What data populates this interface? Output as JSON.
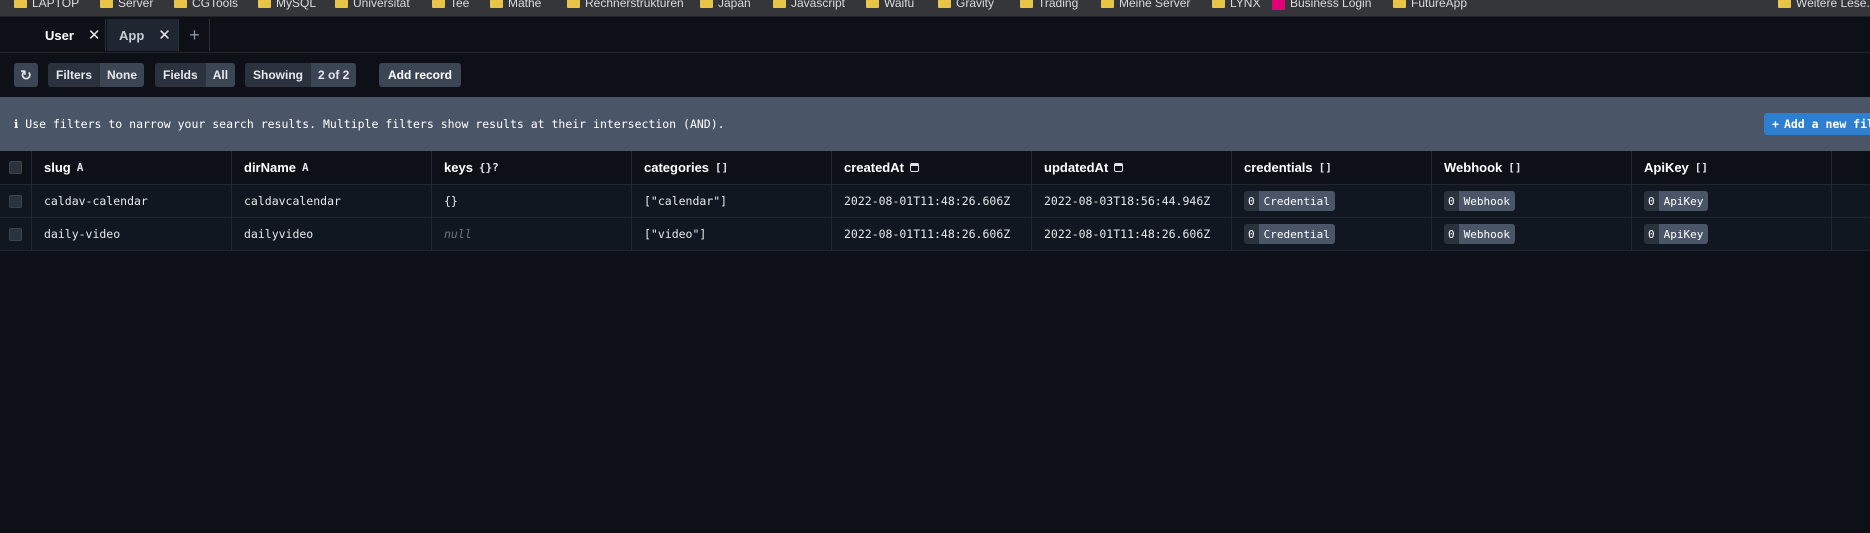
{
  "bookmarks": [
    {
      "label": "LAPTOP",
      "icon": "folder-icon"
    },
    {
      "label": "Server",
      "icon": "folder-icon"
    },
    {
      "label": "CGTools",
      "icon": "folder-icon"
    },
    {
      "label": "MySQL",
      "icon": "folder-icon"
    },
    {
      "label": "Universität",
      "icon": "folder-icon"
    },
    {
      "label": "Tee",
      "icon": "folder-icon"
    },
    {
      "label": "Mathe",
      "icon": "folder-icon"
    },
    {
      "label": "Rechnerstrukturen",
      "icon": "folder-icon"
    },
    {
      "label": "Japan",
      "icon": "folder-icon"
    },
    {
      "label": "Javascript",
      "icon": "folder-icon"
    },
    {
      "label": "Waifu",
      "icon": "folder-icon"
    },
    {
      "label": "Gravity",
      "icon": "folder-icon"
    },
    {
      "label": "Trading",
      "icon": "folder-icon"
    },
    {
      "label": "Meine Server",
      "icon": "folder-icon"
    },
    {
      "label": "LYNX",
      "icon": "folder-icon"
    },
    {
      "label": "Business Login",
      "icon": "telekom-logo-icon"
    },
    {
      "label": "FutureApp",
      "icon": "folder-icon"
    },
    {
      "label": "Weitere Lese...",
      "icon": "folder-icon"
    }
  ],
  "tabs": [
    {
      "label": "User",
      "close": "✕"
    },
    {
      "label": "App",
      "close": "✕"
    }
  ],
  "tab_add": "+",
  "toolbar": {
    "refresh_icon": "↻",
    "filters_label": "Filters",
    "filters_value": "None",
    "fields_label": "Fields",
    "fields_value": "All",
    "showing_label": "Showing",
    "showing_value": "2 of 2",
    "add_record": "Add record"
  },
  "info": {
    "text": "ℹ Use filters to narrow your search results. Multiple filters show results at their intersection (AND).",
    "add_filter_icon": "+",
    "add_filter": "Add a new fil"
  },
  "columns": [
    {
      "name": "slug",
      "type": "A"
    },
    {
      "name": "dirName",
      "type": "A"
    },
    {
      "name": "keys",
      "type": "{}?"
    },
    {
      "name": "categories",
      "type": "[]"
    },
    {
      "name": "createdAt",
      "type": "calendar-icon"
    },
    {
      "name": "updatedAt",
      "type": "calendar-icon"
    },
    {
      "name": "credentials",
      "type": "[]"
    },
    {
      "name": "Webhook",
      "type": "[]"
    },
    {
      "name": "ApiKey",
      "type": "[]"
    }
  ],
  "rows": [
    {
      "slug": "caldav-calendar",
      "dirName": "caldavcalendar",
      "keys": "{}",
      "categories": "[\"calendar\"]",
      "createdAt": "2022-08-01T11:48:26.606Z",
      "updatedAt": "2022-08-03T18:56:44.946Z",
      "credentials": {
        "count": "0",
        "label": "Credential"
      },
      "webhook": {
        "count": "0",
        "label": "Webhook"
      },
      "apikey": {
        "count": "0",
        "label": "ApiKey"
      }
    },
    {
      "slug": "daily-video",
      "dirName": "dailyvideo",
      "keys": "null",
      "categories": "[\"video\"]",
      "createdAt": "2022-08-01T11:48:26.606Z",
      "updatedAt": "2022-08-01T11:48:26.606Z",
      "credentials": {
        "count": "0",
        "label": "Credential"
      },
      "webhook": {
        "count": "0",
        "label": "Webhook"
      },
      "apikey": {
        "count": "0",
        "label": "ApiKey"
      }
    }
  ]
}
